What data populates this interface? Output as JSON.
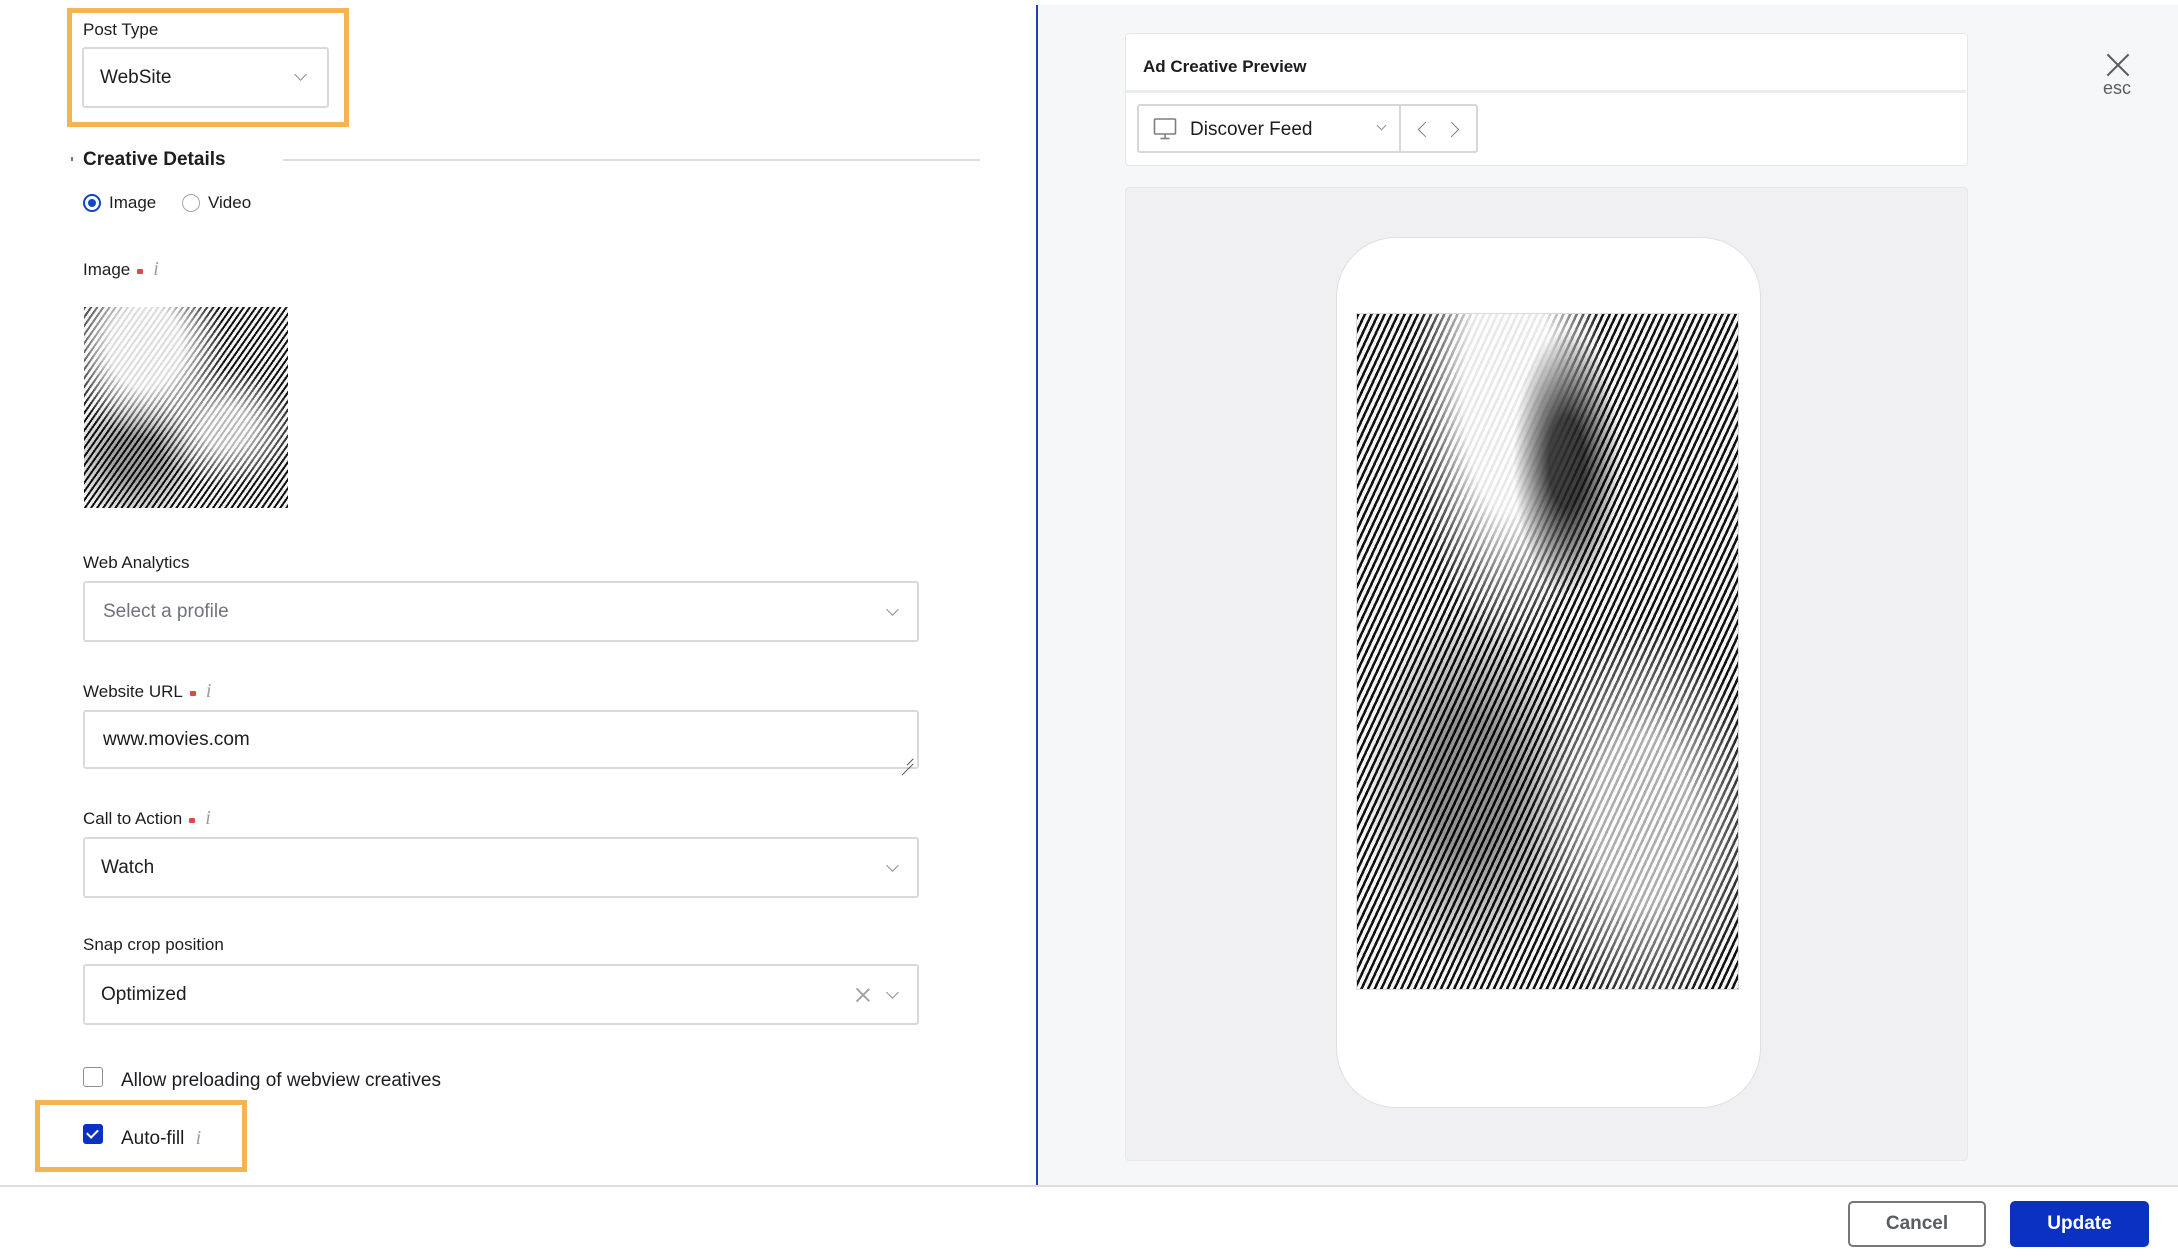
{
  "form": {
    "post_type": {
      "label": "Post Type",
      "value": "WebSite"
    },
    "creative_details": {
      "title": "Creative Details",
      "media_type_options": [
        {
          "label": "Image",
          "selected": true
        },
        {
          "label": "Video",
          "selected": false
        }
      ]
    },
    "image": {
      "label": "Image",
      "required": true,
      "info_icon": "i"
    },
    "web_analytics": {
      "label": "Web Analytics",
      "placeholder": "Select a profile",
      "value": ""
    },
    "website_url": {
      "label": "Website URL",
      "required": true,
      "info_icon": "i",
      "value": "www.movies.com"
    },
    "call_to_action": {
      "label": "Call to Action",
      "required": true,
      "info_icon": "i",
      "value": "Watch"
    },
    "snap_crop_position": {
      "label": "Snap crop position",
      "value": "Optimized"
    },
    "allow_preloading": {
      "label": "Allow preloading of webview creatives",
      "checked": false
    },
    "auto_fill": {
      "label": "Auto-fill",
      "checked": true,
      "info_icon": "i"
    }
  },
  "preview": {
    "title": "Ad Creative Preview",
    "placement": {
      "value": "Discover Feed",
      "icon": "monitor-icon"
    },
    "close": {
      "icon": "close-icon",
      "label": "esc"
    }
  },
  "footer": {
    "cancel_label": "Cancel",
    "update_label": "Update"
  },
  "colors": {
    "accent": "#0a31c2",
    "highlight": "#f2b552",
    "required": "#e04848",
    "divider_blue": "#1d3fc2"
  }
}
